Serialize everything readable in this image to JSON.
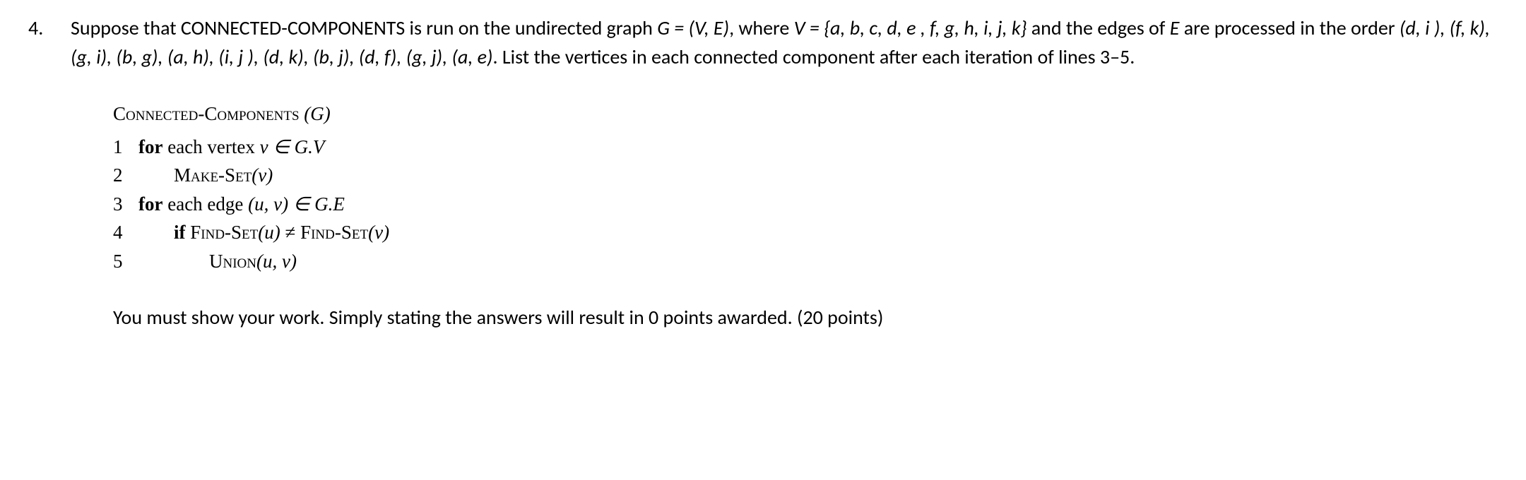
{
  "question": {
    "number": "4.",
    "text_part1": "Suppose that CONNECTED-COMPONENTS is run on the undirected graph ",
    "graph_def": "G = (V, E)",
    "text_part2": ", where ",
    "v_def_prefix": "V = {",
    "v_set": "a, b, c, d, e , f, g, h, i, j, k",
    "v_def_suffix": "}",
    "text_part3": " and the edges of ",
    "e_sym": "E",
    "text_part4": " are processed in the order ",
    "edge_order": "(d, i ), (f, k), (g, i), (b, g), (a, h), (i, j ), (d, k), (b, j), (d, f), (g, j), (a, e)",
    "text_part5": ". List the vertices in each connected component after each iteration of lines 3–5."
  },
  "pseudocode": {
    "title_func": "Connected-Components",
    "title_arg": " (G)",
    "lines": [
      {
        "num": "1",
        "indent": 1,
        "kw": "for",
        "rest_a": " each vertex ",
        "math": "v ∈ G.V",
        "rest_b": ""
      },
      {
        "num": "2",
        "indent": 2,
        "func": "Make-Set",
        "arg": "(v)"
      },
      {
        "num": "3",
        "indent": 1,
        "kw": "for",
        "rest_a": " each edge ",
        "math": "(u, v) ∈ G.E",
        "rest_b": ""
      },
      {
        "num": "4",
        "indent": 2,
        "kw": "if",
        "func1": " Find-Set",
        "arg1": "(u)",
        "op": " ≠ ",
        "func2": "Find-Set",
        "arg2": "(v)"
      },
      {
        "num": "5",
        "indent": 3,
        "func": "Union",
        "arg": "(u, v)"
      }
    ]
  },
  "footer": "You must show your work. Simply stating the answers will result in 0 points awarded. (20 points)"
}
